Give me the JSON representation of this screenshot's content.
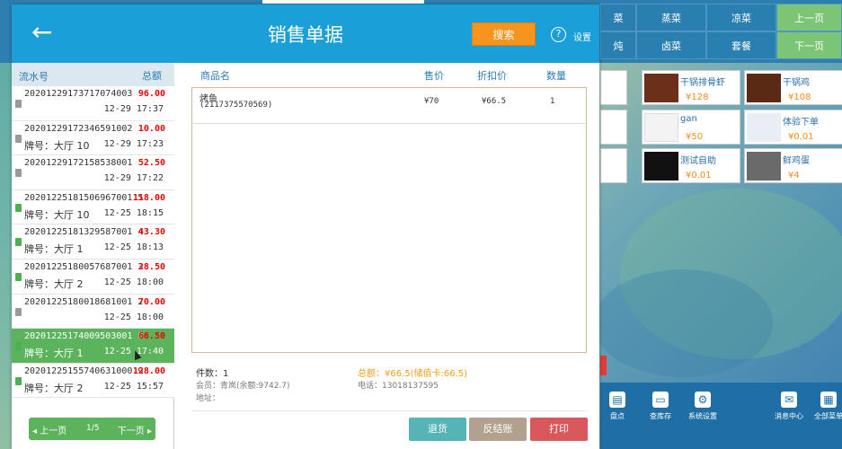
{
  "dialog": {
    "back_icon": "arrow-left-icon",
    "title": "销售单据",
    "search_label": "搜索",
    "help_glyph": "?",
    "settings_label": "设置"
  },
  "left": {
    "col_serial": "流水号",
    "col_total": "总额",
    "records": [
      {
        "serial": "20201229173717074003",
        "amount": "96.00",
        "table": "",
        "datetime": "12-29 17:37",
        "icon": "receipt-gray"
      },
      {
        "serial": "20201229172346591002",
        "amount": "10.00",
        "table": "牌号：大厅 10",
        "datetime": "12-29 17:23",
        "icon": "receipt-gray"
      },
      {
        "serial": "20201229172158538001",
        "amount": "52.50",
        "table": "",
        "datetime": "12-29 17:22",
        "icon": "receipt-gray"
      },
      {
        "serial": "20201225181506967001 5",
        "amount": "118.00",
        "table": "牌号：大厅 10",
        "datetime": "12-25 18:15",
        "icon": "receipt-green"
      },
      {
        "serial": "20201225181329587001 4",
        "amount": "43.30",
        "table": "牌号：大厅 1",
        "datetime": "12-25 18:13",
        "icon": "receipt-green"
      },
      {
        "serial": "20201225180057687001 3",
        "amount": "28.50",
        "table": "牌号：大厅 2",
        "datetime": "12-25 18:00",
        "icon": "receipt-green"
      },
      {
        "serial": "20201225180018681001 2",
        "amount": "70.00",
        "table": "",
        "datetime": "12-25 18:00",
        "icon": "receipt-gray"
      },
      {
        "serial": "20201225174009503001 0",
        "amount": "66.50",
        "table": "牌号：大厅 1",
        "datetime": "12-25 17:40",
        "icon": "receipt-green",
        "selected": true
      },
      {
        "serial": "20201225155740631000 9",
        "amount": "128.00",
        "table": "牌号：大厅 2",
        "datetime": "12-25 15:57",
        "icon": "receipt-green"
      }
    ],
    "pager": {
      "prev": "◂ 上一页",
      "page": "1/5",
      "next": "下一页 ▸"
    }
  },
  "main": {
    "col_name": "商品名",
    "col_price": "售价",
    "col_discount": "折扣价",
    "col_qty": "数量",
    "items": [
      {
        "name": "烤鱼",
        "code": "(2117375570569)",
        "price": "¥70",
        "discount": "¥66.5",
        "qty": "1"
      }
    ],
    "count_label": "件数：1",
    "total_label": "总额：¥66.5(储值卡:66.5)",
    "member_label": "会员：青岚(余额:9742.7)",
    "phone_label": "电话：13018137595",
    "address_label": "地址：",
    "refund_label": "退货",
    "unsettle_label": "反结账",
    "print_label": "打印"
  },
  "background": {
    "categories": [
      "菜",
      "蒸菜",
      "凉菜",
      "上一页",
      "炖",
      "卤菜",
      "套餐",
      "下一页"
    ],
    "products": [
      {
        "name": "干锅排骨虾",
        "price": "¥128"
      },
      {
        "name": "干锅鸡",
        "price": "¥108"
      },
      {
        "name": "gan",
        "price": "¥50"
      },
      {
        "name": "体验下单",
        "price": "¥0.01"
      },
      {
        "name": "测试自助",
        "price": "¥0.01"
      },
      {
        "name": "鲜鸡蛋",
        "price": "¥4"
      }
    ],
    "bottom_nav": [
      {
        "label": "盘点",
        "icon": "clipboard-icon"
      },
      {
        "label": "查库存",
        "icon": "inventory-icon"
      },
      {
        "label": "系统设置",
        "icon": "gear-icon"
      },
      {
        "label": "消息中心",
        "icon": "message-icon"
      },
      {
        "label": "全部菜单",
        "icon": "grid-icon"
      }
    ]
  }
}
